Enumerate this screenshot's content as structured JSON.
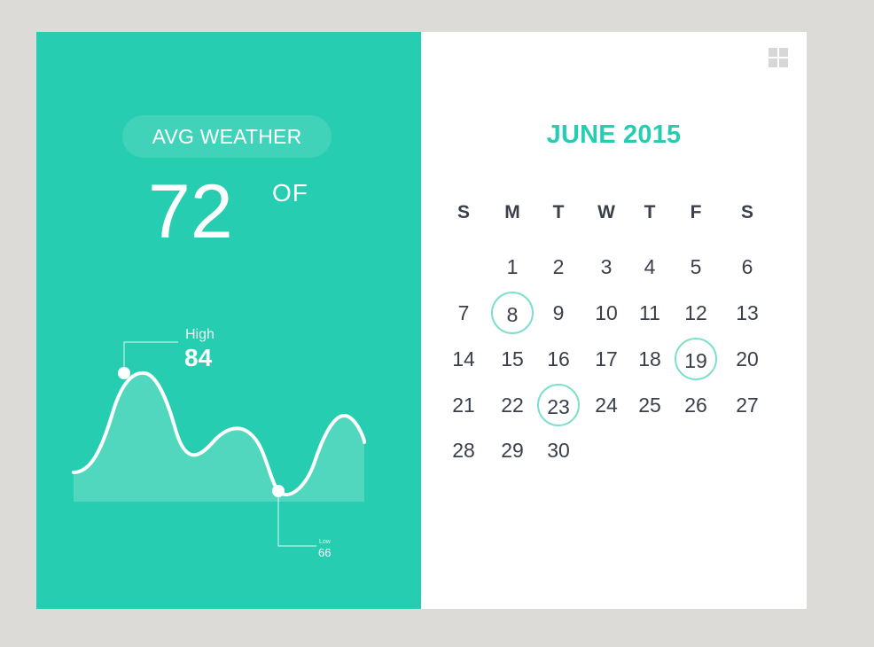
{
  "weather": {
    "label": "AVG WEATHER",
    "temperature": "72",
    "unit": "OF",
    "high_label": "High",
    "high_value": "84",
    "low_label": "Low",
    "low_value": "66"
  },
  "calendar": {
    "title": "JUNE 2015",
    "weekdays": [
      "S",
      "M",
      "T",
      "W",
      "T",
      "F",
      "S"
    ],
    "weeks": [
      [
        "",
        "1",
        "2",
        "3",
        "4",
        "5",
        "6"
      ],
      [
        "7",
        "8",
        "9",
        "10",
        "11",
        "12",
        "13"
      ],
      [
        "14",
        "15",
        "16",
        "17",
        "18",
        "19",
        "20"
      ],
      [
        "21",
        "22",
        "23",
        "24",
        "25",
        "26",
        "27"
      ],
      [
        "28",
        "29",
        "30",
        "",
        "",
        "",
        ""
      ]
    ],
    "highlighted": [
      "8",
      "19",
      "23"
    ]
  },
  "icons": {
    "grid": "grid-icon"
  },
  "colors": {
    "accent": "#27cdb0",
    "ring": "#7ee0cc",
    "text": "#3a3f4a",
    "background": "#dcdbd8"
  }
}
